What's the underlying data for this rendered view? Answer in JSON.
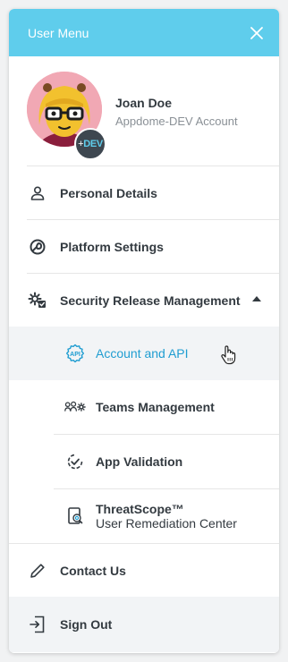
{
  "header": {
    "title": "User Menu"
  },
  "profile": {
    "name": "Joan Doe",
    "account": "Appdome-DEV Account",
    "badge_plus": "+",
    "badge_text": "DEV"
  },
  "menu": {
    "personal_details": "Personal Details",
    "platform_settings": "Platform Settings",
    "security_release": "Security Release Management",
    "contact_us": "Contact Us",
    "sign_out": "Sign Out"
  },
  "submenu": {
    "account_api": "Account and API",
    "api_icon_text": "API",
    "teams": "Teams Management",
    "app_validation": "App Validation",
    "threatscope_line1": "ThreatScope™",
    "threatscope_line2": "User Remediation Center"
  },
  "colors": {
    "header_bg": "#5fcdec",
    "active_text": "#1f9dd1",
    "badge_bg": "#3e4750"
  }
}
